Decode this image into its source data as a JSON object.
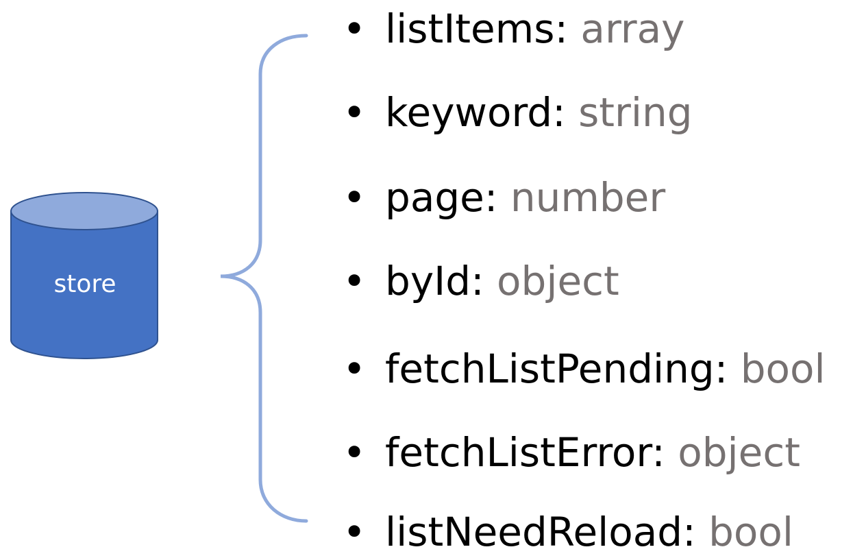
{
  "store": {
    "label": "store",
    "colors": {
      "body": "#4472C4",
      "top": "#8FAADC",
      "outline": "#2F528F",
      "brace": "#8FAADC"
    }
  },
  "fields": [
    {
      "name": "listItems",
      "type": "array"
    },
    {
      "name": "keyword",
      "type": "string"
    },
    {
      "name": "page",
      "type": "number"
    },
    {
      "name": "byId",
      "type": "object"
    },
    {
      "name": "fetchListPending",
      "type": "bool"
    },
    {
      "name": "fetchListError",
      "type": "object"
    },
    {
      "name": "listNeedReload",
      "type": "bool"
    }
  ],
  "colors": {
    "name_text": "#000000",
    "type_text": "#767171"
  }
}
